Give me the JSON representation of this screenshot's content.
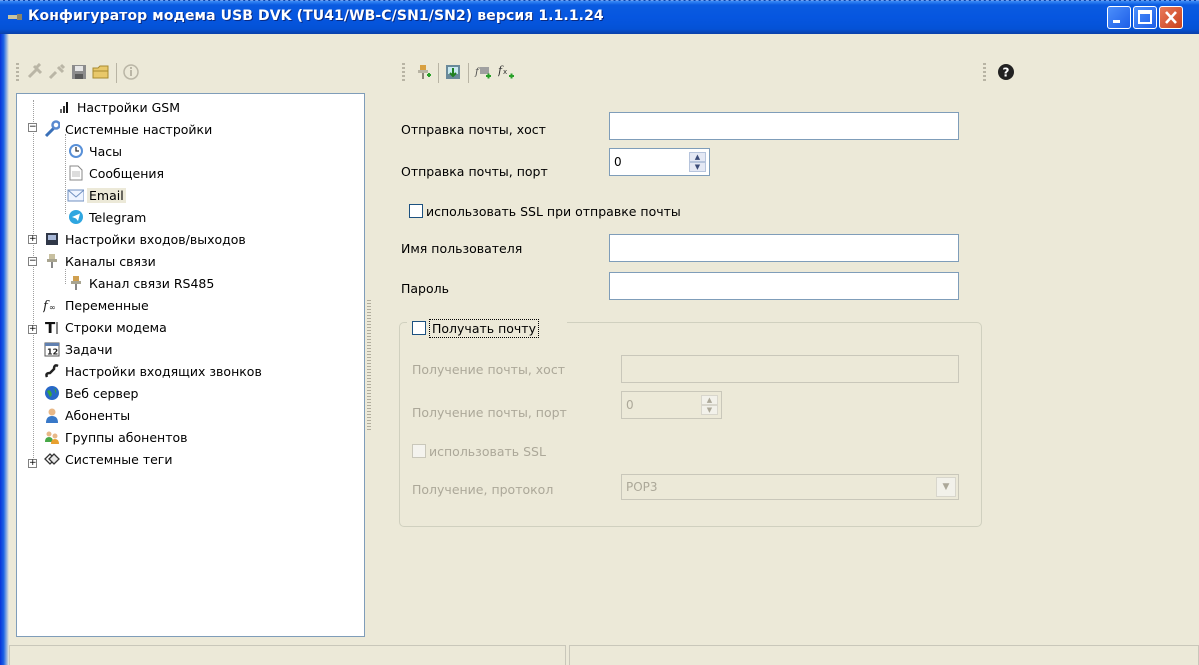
{
  "window": {
    "title": "Конфигуратор модема USB DVK (TU41/WB-C/SN1/SN2)  версия 1.1.1.24"
  },
  "toolbar_left": {
    "icons": [
      "connect-icon",
      "disconnect-icon",
      "save-icon",
      "open-folder-icon",
      "info-icon"
    ]
  },
  "toolbar_mid": {
    "icons": [
      "add-channel-icon",
      "import-icon",
      "add-variable-icon",
      "add-function-icon"
    ]
  },
  "toolbar_right": {
    "icons": [
      "help-icon"
    ]
  },
  "tree": {
    "items": [
      {
        "label": "Настройки GSM",
        "icon": "gsm-signal-icon"
      },
      {
        "label": "Системные настройки",
        "icon": "wrench-icon"
      },
      {
        "label": "Часы",
        "icon": "clock-icon"
      },
      {
        "label": "Сообщения",
        "icon": "document-icon"
      },
      {
        "label": "Email",
        "icon": "envelope-icon"
      },
      {
        "label": "Telegram",
        "icon": "telegram-icon"
      },
      {
        "label": "Настройки входов/выходов",
        "icon": "io-icon"
      },
      {
        "label": "Каналы связи",
        "icon": "channel-icon"
      },
      {
        "label": "Канал связи RS485",
        "icon": "channel-icon"
      },
      {
        "label": "Переменные",
        "icon": "variable-icon"
      },
      {
        "label": "Строки модема",
        "icon": "text-icon"
      },
      {
        "label": "Задачи",
        "icon": "calendar-icon"
      },
      {
        "label": "Настройки входящих звонков",
        "icon": "phone-icon"
      },
      {
        "label": "Веб сервер",
        "icon": "globe-icon"
      },
      {
        "label": "Абоненты",
        "icon": "user-icon"
      },
      {
        "label": "Группы абонентов",
        "icon": "users-icon"
      },
      {
        "label": "Системные теги",
        "icon": "tags-icon"
      }
    ],
    "calendar_number": "12"
  },
  "form": {
    "send_host_label": "Отправка почты, хост",
    "send_host_value": "",
    "send_port_label": "Отправка почты, порт",
    "send_port_value": "0",
    "ssl_send_label": "использовать SSL при отправке почты",
    "username_label": "Имя пользователя",
    "username_value": "",
    "password_label": "Пароль",
    "password_value": "",
    "receive_group": {
      "receive_label": "Получать почту",
      "recv_host_label": "Получение почты, хост",
      "recv_host_value": "",
      "recv_port_label": "Получение почты, порт",
      "recv_port_value": "0",
      "ssl_label": "использовать SSL",
      "protocol_label": "Получение, протокол",
      "protocol_value": "POP3"
    }
  },
  "colors": {
    "titlebar": "#0656E0",
    "window_bg": "#ECE9D8",
    "close_button": "#c8401c"
  }
}
